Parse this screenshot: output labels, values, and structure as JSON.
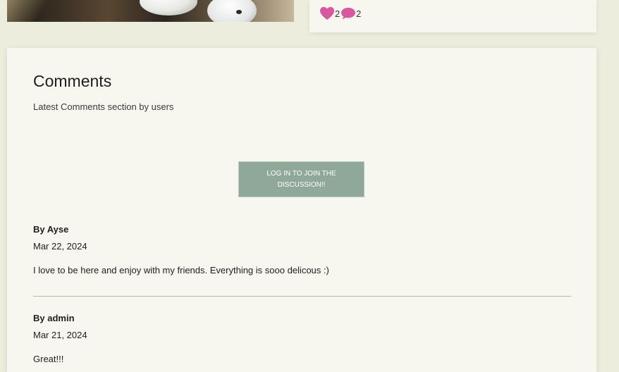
{
  "post": {
    "likes": "2",
    "comments": "2",
    "colors": {
      "heart": "#d9579f",
      "bubble": "#d9579f"
    }
  },
  "comments_section": {
    "title": "Comments",
    "subtitle": "Latest Comments section by users",
    "login_button": "LOG IN TO JOIN THE DISCUSSION!!",
    "items": [
      {
        "author": "By Ayse",
        "date": "Mar 22, 2024",
        "text": "I love to be here and enjoy with my friends. Everything is sooo delicous :)"
      },
      {
        "author": "By admin",
        "date": "Mar 21, 2024",
        "text": "Great!!!"
      }
    ]
  }
}
